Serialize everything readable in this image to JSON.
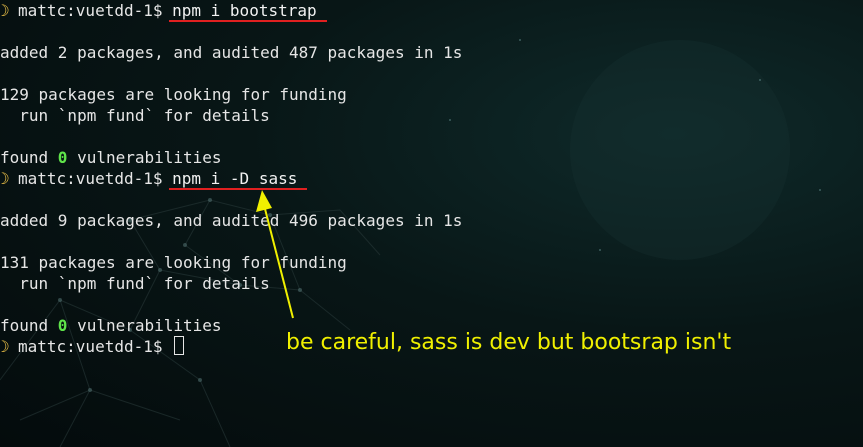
{
  "terminal": {
    "prompt": "mattc:vuetdd-1$ ",
    "lines": [
      {
        "type": "prompt",
        "command": "npm i bootstrap"
      },
      {
        "type": "text",
        "text": ""
      },
      {
        "type": "text",
        "text": "added 2 packages, and audited 487 packages in 1s"
      },
      {
        "type": "text",
        "text": ""
      },
      {
        "type": "text",
        "text": "129 packages are looking for funding"
      },
      {
        "type": "text",
        "text": "  run `npm fund` for details"
      },
      {
        "type": "text",
        "text": ""
      },
      {
        "type": "vuln",
        "prefix": "found ",
        "count": "0",
        "suffix": " vulnerabilities"
      },
      {
        "type": "prompt",
        "command": "npm i -D sass"
      },
      {
        "type": "text",
        "text": ""
      },
      {
        "type": "text",
        "text": "added 9 packages, and audited 496 packages in 1s"
      },
      {
        "type": "text",
        "text": ""
      },
      {
        "type": "text",
        "text": "131 packages are looking for funding"
      },
      {
        "type": "text",
        "text": "  run `npm fund` for details"
      },
      {
        "type": "text",
        "text": ""
      },
      {
        "type": "vuln",
        "prefix": "found ",
        "count": "0",
        "suffix": " vulnerabilities"
      },
      {
        "type": "prompt-cursor"
      }
    ]
  },
  "annotation": {
    "text": "be careful, sass is dev but bootsrap isn't",
    "color": "#f0f000"
  },
  "colors": {
    "underline": "#e02020",
    "vuln_count": "#5fe34a",
    "moon": "#f5c84a"
  },
  "icons": {
    "prompt_icon": "crescent-moon-icon"
  }
}
